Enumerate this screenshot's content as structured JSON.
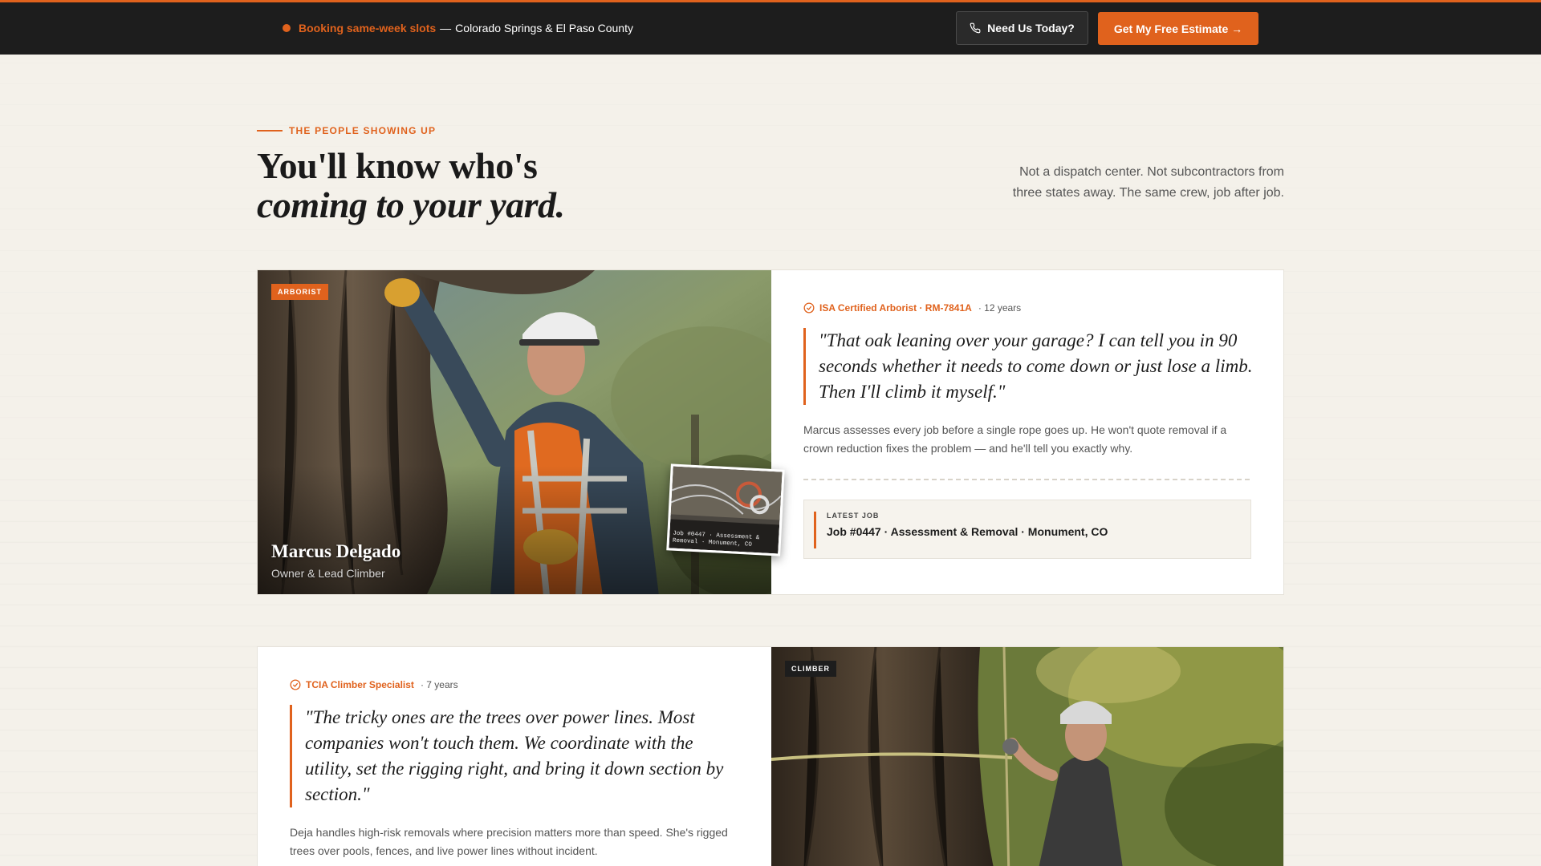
{
  "topbar": {
    "status_highlight": "Booking same-week slots",
    "status_separator": "—",
    "status_text": "Colorado Springs & El Paso County",
    "call_button": "Need Us Today?",
    "estimate_button": "Get My Free Estimate →"
  },
  "section": {
    "eyebrow": "THE PEOPLE SHOWING UP",
    "headline_line1": "You'll know who's",
    "headline_line2": "coming to your yard.",
    "intro": "Not a dispatch center. Not subcontractors from three states away. The same crew, job after job."
  },
  "crew": [
    {
      "badge": "ARBORIST",
      "name": "Marcus Delgado",
      "role": "Owner & Lead Climber",
      "certification": "ISA Certified Arborist · RM-7841A",
      "years": "· 12 years",
      "quote": "\"That oak leaning over your garage? I can tell you in 90 seconds whether it needs to come down or just lose a limb. Then I'll climb it myself.\"",
      "description": "Marcus assesses every job before a single rope goes up. He won't quote removal if a crown reduction fixes the problem — and he'll tell you exactly why.",
      "photo_caption": "Job #0447 · Assessment & Removal · Monument, CO",
      "latest_label": "LATEST JOB",
      "latest_job": "Job #0447 · Assessment & Removal · Monument, CO"
    },
    {
      "badge": "CLIMBER",
      "certification": "TCIA Climber Specialist",
      "years": "· 7 years",
      "quote": "\"The tricky ones are the trees over power lines. Most companies won't touch them. We coordinate with the utility, set the rigging right, and bring it down section by section.\"",
      "description": "Deja handles high-risk removals where precision matters more than speed. She's rigged trees over pools, fences, and live power lines without incident."
    }
  ],
  "colors": {
    "accent": "#e0621d",
    "topbar_bg": "#1d1d1d",
    "page_bg": "#f4f1ea"
  },
  "icons": [
    "phone-icon",
    "check-circle-icon",
    "status-dot-icon"
  ]
}
